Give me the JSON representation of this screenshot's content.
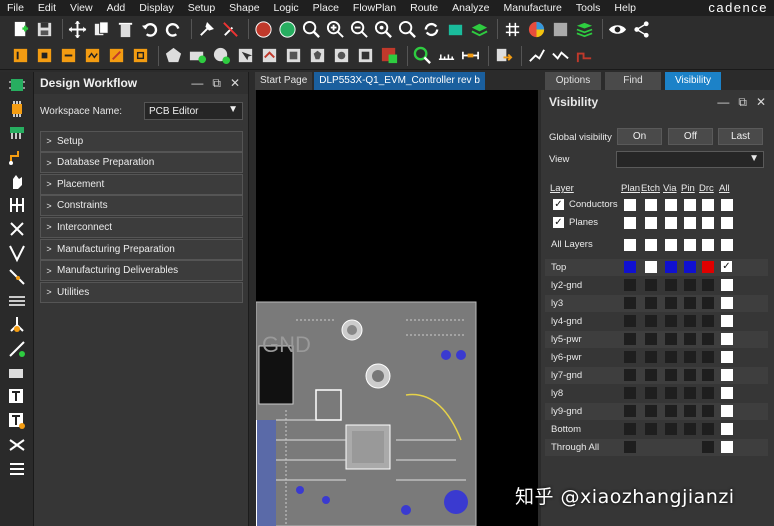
{
  "menu": [
    "File",
    "Edit",
    "View",
    "Add",
    "Display",
    "Setup",
    "Shape",
    "Logic",
    "Place",
    "FlowPlan",
    "Route",
    "Analyze",
    "Manufacture",
    "Tools",
    "Help"
  ],
  "brand": "cadence",
  "workflow": {
    "title": "Design Workflow",
    "workspace_label": "Workspace Name:",
    "workspace_value": "PCB Editor",
    "items": [
      "Setup",
      "Database Preparation",
      "Placement",
      "Constraints",
      "Interconnect",
      "Manufacturing Preparation",
      "Manufacturing Deliverables",
      "Utilities"
    ]
  },
  "tabs": [
    "Start Page",
    "DLP553X-Q1_EVM_Controller rev b"
  ],
  "right_tabs": [
    "Options",
    "Find",
    "Visibility"
  ],
  "visibility": {
    "title": "Visibility",
    "global_label": "Global visibility",
    "buttons": [
      "On",
      "Off",
      "Last"
    ],
    "view_label": "View",
    "layer_header": "Layer",
    "col_headers": [
      "Plan",
      "Etch",
      "Via",
      "Pin",
      "Drc",
      "All"
    ],
    "conductors": "Conductors",
    "planes": "Planes",
    "all_layers": "All Layers",
    "layers": [
      "Top",
      "ly2-gnd",
      "ly3",
      "ly4-gnd",
      "ly5-pwr",
      "ly6-pwr",
      "ly7-gnd",
      "ly8",
      "ly9-gnd",
      "Bottom",
      "Through All"
    ],
    "top_colors": [
      "#1010d0",
      "#ffffff",
      "#1010d0",
      "#1010d0",
      "#e00000"
    ]
  },
  "canvas": {
    "board_text": "GND"
  },
  "watermark": "知乎 @xiaozhangjianzi"
}
